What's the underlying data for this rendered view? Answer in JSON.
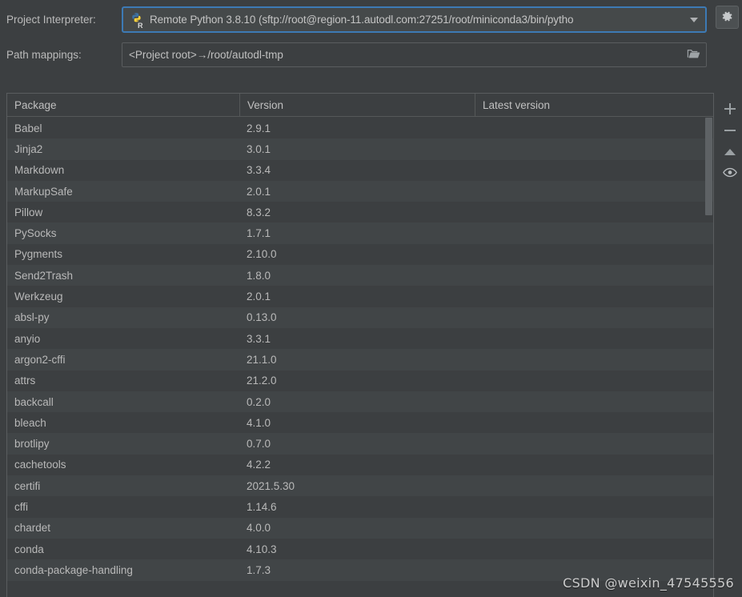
{
  "form": {
    "interpreter_label": "Project Interpreter:",
    "interpreter_value": "Remote Python 3.8.10 (sftp://root@region-11.autodl.com:27251/root/miniconda3/bin/pytho",
    "interpreter_icon": "python-remote-icon",
    "dropdown_icon": "chevron-down-icon",
    "gear_icon": "gear-icon",
    "pathmap_label": "Path mappings:",
    "pathmap_value": "<Project root>→/root/autodl-tmp",
    "folder_icon": "folder-icon"
  },
  "table": {
    "columns": [
      "Package",
      "Version",
      "Latest version"
    ],
    "rows": [
      {
        "package": "Babel",
        "version": "2.9.1",
        "latest": ""
      },
      {
        "package": "Jinja2",
        "version": "3.0.1",
        "latest": ""
      },
      {
        "package": "Markdown",
        "version": "3.3.4",
        "latest": ""
      },
      {
        "package": "MarkupSafe",
        "version": "2.0.1",
        "latest": ""
      },
      {
        "package": "Pillow",
        "version": "8.3.2",
        "latest": ""
      },
      {
        "package": "PySocks",
        "version": "1.7.1",
        "latest": ""
      },
      {
        "package": "Pygments",
        "version": "2.10.0",
        "latest": ""
      },
      {
        "package": "Send2Trash",
        "version": "1.8.0",
        "latest": ""
      },
      {
        "package": "Werkzeug",
        "version": "2.0.1",
        "latest": ""
      },
      {
        "package": "absl-py",
        "version": "0.13.0",
        "latest": ""
      },
      {
        "package": "anyio",
        "version": "3.3.1",
        "latest": ""
      },
      {
        "package": "argon2-cffi",
        "version": "21.1.0",
        "latest": ""
      },
      {
        "package": "attrs",
        "version": "21.2.0",
        "latest": ""
      },
      {
        "package": "backcall",
        "version": "0.2.0",
        "latest": ""
      },
      {
        "package": "bleach",
        "version": "4.1.0",
        "latest": ""
      },
      {
        "package": "brotlipy",
        "version": "0.7.0",
        "latest": ""
      },
      {
        "package": "cachetools",
        "version": "4.2.2",
        "latest": ""
      },
      {
        "package": "certifi",
        "version": "2021.5.30",
        "latest": ""
      },
      {
        "package": "cffi",
        "version": "1.14.6",
        "latest": ""
      },
      {
        "package": "chardet",
        "version": "4.0.0",
        "latest": ""
      },
      {
        "package": "conda",
        "version": "4.10.3",
        "latest": ""
      },
      {
        "package": "conda-package-handling",
        "version": "1.7.3",
        "latest": ""
      },
      {
        "package": "",
        "version": "",
        "latest": ""
      }
    ]
  },
  "side_toolbar": {
    "buttons": [
      {
        "name": "add-package-button",
        "icon": "plus-icon"
      },
      {
        "name": "remove-package-button",
        "icon": "minus-icon"
      },
      {
        "name": "upgrade-package-button",
        "icon": "up-arrow-icon"
      },
      {
        "name": "show-early-releases-button",
        "icon": "eye-icon"
      }
    ]
  },
  "watermark": "CSDN @weixin_47545556",
  "colors": {
    "background": "#3c3f41",
    "row_alt": "#414547",
    "accent": "#3d7ab5",
    "text": "#bbbbbb",
    "border": "#5a5d5f"
  }
}
